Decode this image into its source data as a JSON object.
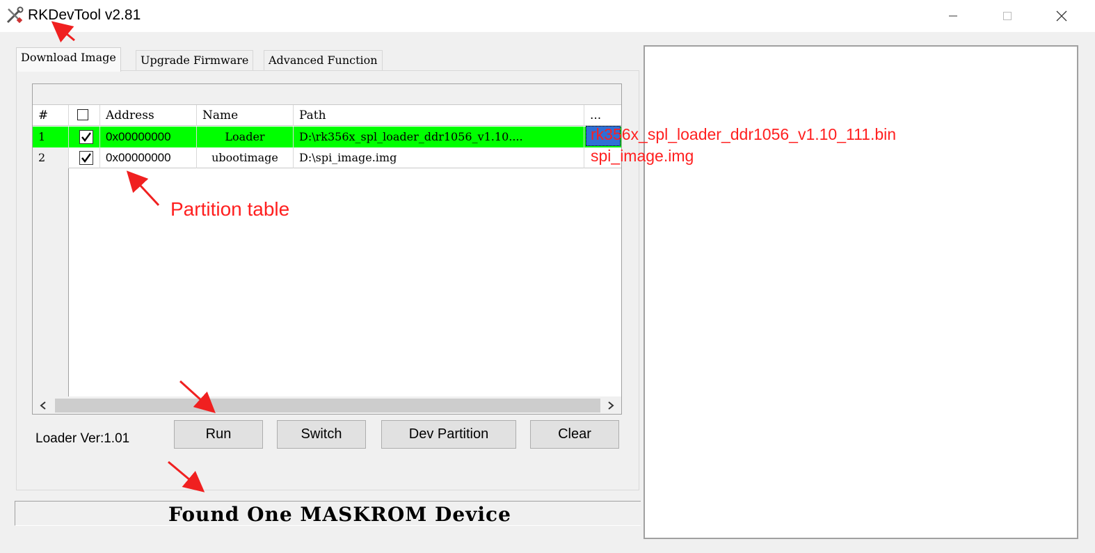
{
  "window": {
    "title": "RKDevTool v2.81",
    "icon": "wrench-screwdriver-icon"
  },
  "tabs": [
    {
      "label": "Download Image",
      "active": true
    },
    {
      "label": "Upgrade Firmware",
      "active": false
    },
    {
      "label": "Advanced Function",
      "active": false
    }
  ],
  "table": {
    "columns": [
      "#",
      "",
      "Address",
      "Name",
      "Path",
      "..."
    ],
    "rows": [
      {
        "num": "1",
        "checked": true,
        "address": "0x00000000",
        "name": "Loader",
        "path": "D:\\rk356x_spl_loader_ddr1056_v1.10....",
        "highlight": "#00ff00"
      },
      {
        "num": "2",
        "checked": true,
        "address": "0x00000000",
        "name": "ubootimage",
        "path": "D:\\spi_image.img",
        "highlight": null
      }
    ]
  },
  "footer": {
    "loader_version": "Loader Ver:1.01"
  },
  "buttons": {
    "run": "Run",
    "switch": "Switch",
    "dev_partition": "Dev Partition",
    "clear": "Clear"
  },
  "status": {
    "message": "Found One MASKROM Device"
  },
  "annotations": {
    "partition_table": "Partition table",
    "file1": "rk356x_spl_loader_ddr1056_v1.10_111.bin",
    "file2": "spi_image.img",
    "color": "#ff1f1f"
  }
}
